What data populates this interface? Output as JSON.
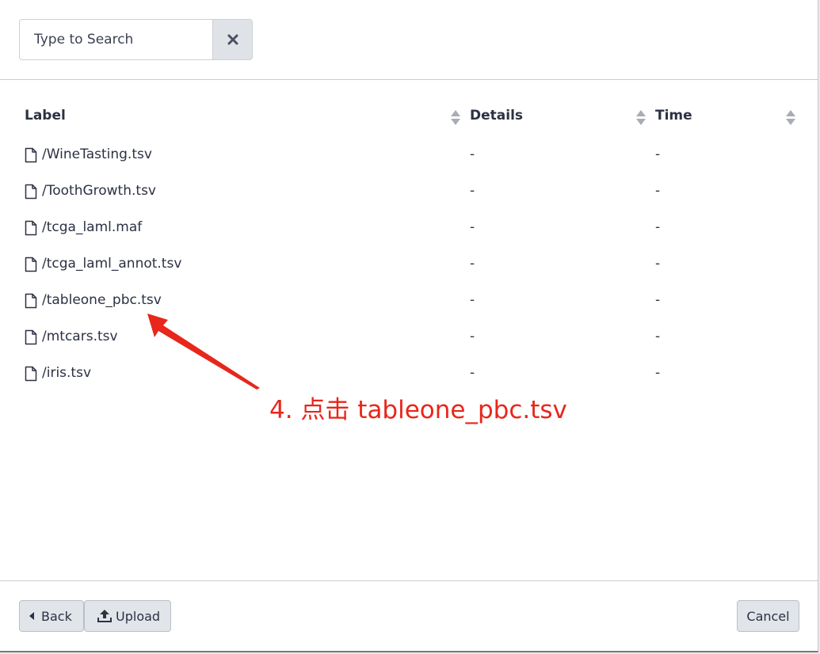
{
  "search": {
    "placeholder": "Type to Search"
  },
  "table": {
    "columns": [
      "Label",
      "Details",
      "Time"
    ],
    "rows": [
      {
        "label": "/WineTasting.tsv",
        "details": "-",
        "time": "-"
      },
      {
        "label": "/ToothGrowth.tsv",
        "details": "-",
        "time": "-"
      },
      {
        "label": "/tcga_laml.maf",
        "details": "-",
        "time": "-"
      },
      {
        "label": "/tcga_laml_annot.tsv",
        "details": "-",
        "time": "-"
      },
      {
        "label": "/tableone_pbc.tsv",
        "details": "-",
        "time": "-"
      },
      {
        "label": "/mtcars.tsv",
        "details": "-",
        "time": "-"
      },
      {
        "label": "/iris.tsv",
        "details": "-",
        "time": "-"
      }
    ]
  },
  "annotation": {
    "text": "4. 点击 tableone_pbc.tsv",
    "color": "#e8261b"
  },
  "footer": {
    "back_label": "Back",
    "upload_label": "Upload",
    "cancel_label": "Cancel"
  },
  "icons": {
    "clear": "close-icon",
    "file": "file-icon",
    "sort": "sort-icon",
    "back": "caret-left-icon",
    "upload": "upload-icon"
  }
}
